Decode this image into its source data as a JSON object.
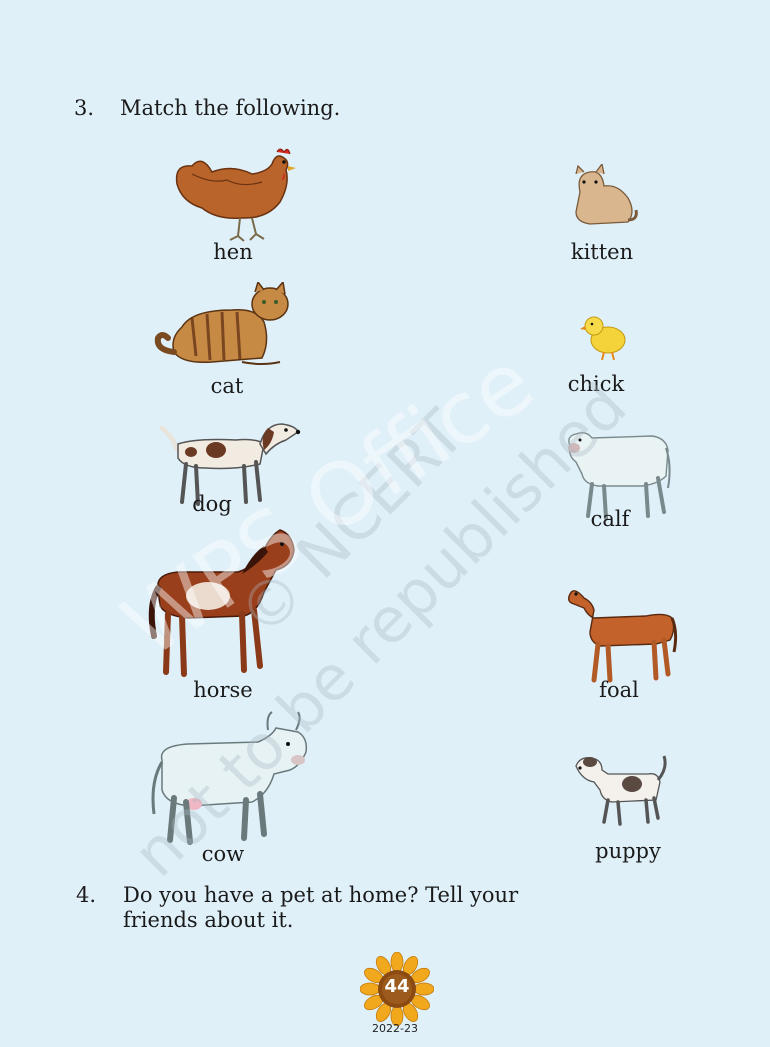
{
  "question3": {
    "number": "3.",
    "text": "Match the following."
  },
  "left_column": [
    {
      "label": "hen",
      "icon": "hen-illustration"
    },
    {
      "label": "cat",
      "icon": "cat-illustration"
    },
    {
      "label": "dog",
      "icon": "dog-illustration"
    },
    {
      "label": "horse",
      "icon": "horse-illustration"
    },
    {
      "label": "cow",
      "icon": "cow-illustration"
    }
  ],
  "right_column": [
    {
      "label": "kitten",
      "icon": "kitten-illustration"
    },
    {
      "label": "chick",
      "icon": "chick-illustration"
    },
    {
      "label": "calf",
      "icon": "calf-illustration"
    },
    {
      "label": "foal",
      "icon": "foal-illustration"
    },
    {
      "label": "puppy",
      "icon": "puppy-illustration"
    }
  ],
  "question4": {
    "number": "4.",
    "line1": "Do you have a pet at home? Tell your",
    "line2": "friends about it."
  },
  "watermark": {
    "line1": "© NCERT",
    "line2": "not to be republished",
    "overlay": "WPS Office"
  },
  "footer": {
    "page_number": "44",
    "year": "2022-23"
  },
  "colors": {
    "background": "#dff0f9",
    "badge": "#f2a81d",
    "badge_center": "#8a4a12"
  }
}
